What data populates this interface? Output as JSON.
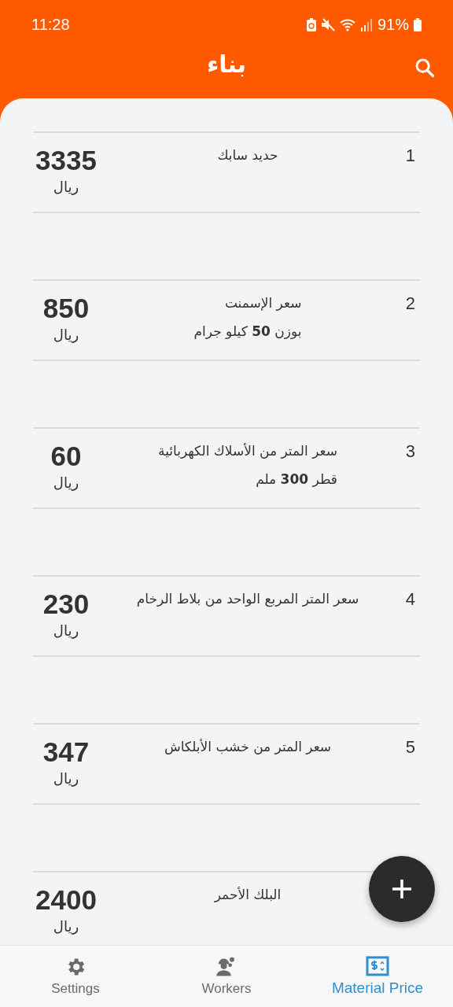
{
  "status_bar": {
    "time": "11:28",
    "battery": "91%"
  },
  "app_bar": {
    "title": "بناء"
  },
  "items": [
    {
      "index": "1",
      "lines": [
        "حديد سابك"
      ],
      "price": "3335",
      "currency": "ريال"
    },
    {
      "index": "2",
      "lines": [
        "سعر الإسمنت",
        "بوزن **50** كيلو جرام"
      ],
      "price": "850",
      "currency": "ريال"
    },
    {
      "index": "3",
      "lines": [
        "سعر المتر من الأسلاك الكهربائية",
        "قطر **300** ملم"
      ],
      "price": "60",
      "currency": "ريال"
    },
    {
      "index": "4",
      "lines": [
        "سعر المتر المربع الواحد من بلاط الرخام"
      ],
      "price": "230",
      "currency": "ريال"
    },
    {
      "index": "5",
      "lines": [
        "سعر المتر من خشب الأبلكاش"
      ],
      "price": "347",
      "currency": "ريال"
    },
    {
      "lines": [
        "البلك الأحمر"
      ],
      "price": "2400",
      "currency": "ريال"
    }
  ],
  "nav": [
    {
      "kind": "price",
      "label": "Material Price",
      "selected": true
    },
    {
      "kind": "workers",
      "label": "Workers",
      "selected": false
    },
    {
      "kind": "settings",
      "label": "Settings",
      "selected": false
    }
  ]
}
